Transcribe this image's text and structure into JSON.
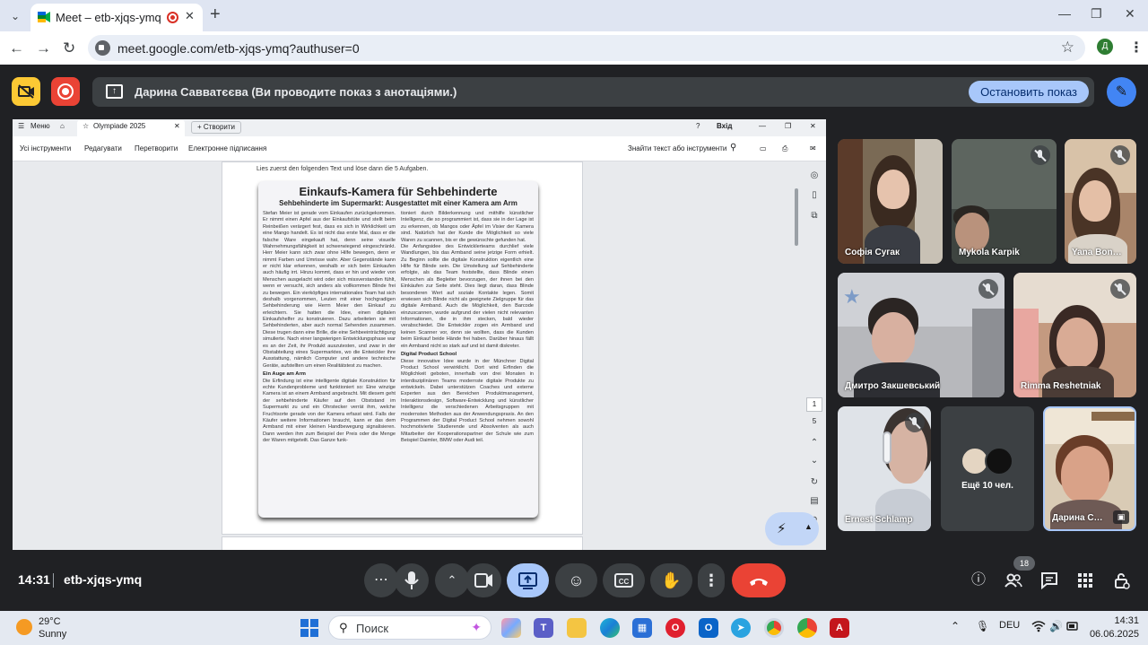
{
  "browser": {
    "tab_title": "Meet – etb-xjqs-ymq",
    "new_tab": "+",
    "url": "meet.google.com/etb-xjqs-ymq?authuser=0",
    "profile_initial": "Д"
  },
  "meet_top": {
    "presenting_text": "Дарина Савватєєва (Ви проводите показ з анотаціями.)",
    "stop_label": "Остановить показ"
  },
  "pdf": {
    "menu_label": "Меню",
    "tab_title": "Olympiade 2025",
    "create_label": "+ Створити",
    "sign_in": "Вхід",
    "tools": [
      "Усі інструменти",
      "Редагувати",
      "Перетворити",
      "Електронне підписання"
    ],
    "find_placeholder": "Знайти текст або інструменти",
    "intro": "Lies zuerst den folgenden Text und löse dann die 5 Aufgaben.",
    "title": "Einkaufs-Kamera für Sehbehinderte",
    "subtitle": "Sehbehinderte im Supermarkt: Ausgestattet mit einer Kamera am Arm",
    "col1_p1": "Stefan Meier ist gerade vom Einkaufen zurückgekommen. Er nimmt einen Apfel aus der Einkaufstüte und stellt beim Reinbeißen verärgert fest, dass es sich in Wirklichkeit um eine Mango handelt. Es ist nicht das erste Mal, dass er die falsche Ware eingekauft hat, denn seine visuelle Wahrnehmungsfähigkeit ist schwerwiegend eingeschränkt. Herr Meier kann sich zwar ohne Hilfe bewegen, denn er nimmt Farben und Umrisse wahr. Aber Gegenstände kann er nicht klar erkennen, weshalb er sich beim Einkaufen auch häufig irrt. Hinzu kommt, dass er hin und wieder von Menschen ausgelacht wird oder sich missverstanden fühlt, wenn er versucht, sich anders als vollkommen Blinde frei zu bewegen. Ein vierköpfiges internationales Team hat sich deshalb vorgenommen, Leuten mit einer hochgradigen Sehbehinderung wie Herrn Meier den Einkauf zu erleichtern. Sie hatten die Idee, einen digitalen Einkaufshelfer zu konstruieren. Dazu arbeiteten sie mit Sehbehinderten, aber auch normal Sehenden zusammen. Diese trugen dann eine Brille, die eine Sehbeeinträchtigung simulierte. Nach einer langwierigen Entwicklungsphase war es an der Zeit, ihr Produkt auszutesten, und zwar in der Obstabteilung eines Supermarktes, wo die Entwickler ihre Ausstattung, nämlich Computer und andere technische Geräte, aufstellten um einen Realitätstest zu machen.",
    "col1_h": "Ein Auge am Arm",
    "col1_p2": "Die Erfindung ist eine intelligente digitale Konstruktion für echte Kundenprobleme und funktioniert so: Eine winzige Kamera ist an einem Armband angebracht. Mit diesem geht der sehbehinderte Käufer auf den Obststand im Supermarkt zu und ein Ohrstecker verrät ihm, welche Fruchtsorte gerade von der Kamera erfasst wird. Falls der Käufer weitere Informationen braucht, kann er das dem Armband mit einer kleinen Handbewegung signalisieren. Dann werden ihm zum Beispiel der Preis oder die Menge der Waren mitgeteilt. Das Ganze funk-",
    "col2_p1": "tioniert durch Bilderkennung und mithilfe künstlicher Intelligenz, die so programmiert ist, dass sie in der Lage ist zu erkennen, ob Mangos oder Äpfel im Visier der Kamera sind. Natürlich hat der Kunde die Möglichkeit so viele Waren zu scannen, bis er die gewünschte gefunden hat.",
    "col2_p2": "Die Anfangsidee des Entwicklerteams durchlief viele Wandlungen, bis das Armband seine jetzige Form erhielt. Zu Beginn sollte die digitale Konstruktion eigentlich eine Hilfe für Blinde sein. Die Umstellung auf Sehbehinderte erfolgte, als das Team feststellte, dass Blinde einen Menschen als Begleiter bevorzugen, der ihnen bei den Einkäufen zur Seite steht. Dies liegt daran, dass Blinde besonderen Wert auf soziale Kontakte legen. Somit erwiesen sich Blinde nicht als geeignete Zielgruppe für das digitale Armband. Auch die Möglichkeit, den Barcode einzuscannen, wurde aufgrund der vielen nicht relevanten Informationen, die in ihm stecken, bald wieder verabschiedet. Die Entwickler zogen ein Armband und keinen Scanner vor, denn sie wollten, dass die Kunden beim Einkauf beide Hände frei haben. Darüber hinaus fällt ein Armband nicht so stark auf und ist damit diskreter.",
    "col2_h": "Digital Product School",
    "col2_p3": "Diese innovative Idee wurde in der Münchner Digital Product School verwirklicht. Dort wird Erfinden die Möglichkeit geboten, innerhalb von drei Monaten in interdisziplinären Teams modernste digitale Produkte zu entwickeln. Dabei unterstützen Coaches und externe Experten aus den Bereichen Produktmanagement, Interaktionsdesign, Software-Entwicklung und künstlicher Intelligenz die verschiedenen Arbeitsgruppen mit modernsten Methoden aus der Anwendungspraxis. An den Programmen der Digital Product School nehmen sowohl hochmotivierte Studierende und Absolventen als auch Mitarbeiter der Kooperationspartner der Schule wie zum Beispiel Daimler, BMW oder Audi teil.",
    "page_current": "1",
    "page_total": "5"
  },
  "participants": [
    {
      "name": "Софія Сугак"
    },
    {
      "name": "Mykola Karpik"
    },
    {
      "name": "Yana Bon…"
    },
    {
      "name": "Дмитро Закшевський"
    },
    {
      "name": "Rimma Reshetniak"
    },
    {
      "name": "Ernest Schlamp"
    },
    {
      "name": "Дарина С…"
    }
  ],
  "more_label": "Ещё 10 чел.",
  "meet_bottom": {
    "time": "14:31",
    "meeting_code": "etb-xjqs-ymq",
    "participants_count": "18"
  },
  "taskbar": {
    "temperature": "29°C",
    "condition": "Sunny",
    "search_placeholder": "Поиск",
    "language": "DEU",
    "clock_time": "14:31",
    "clock_date": "06.06.2025"
  }
}
